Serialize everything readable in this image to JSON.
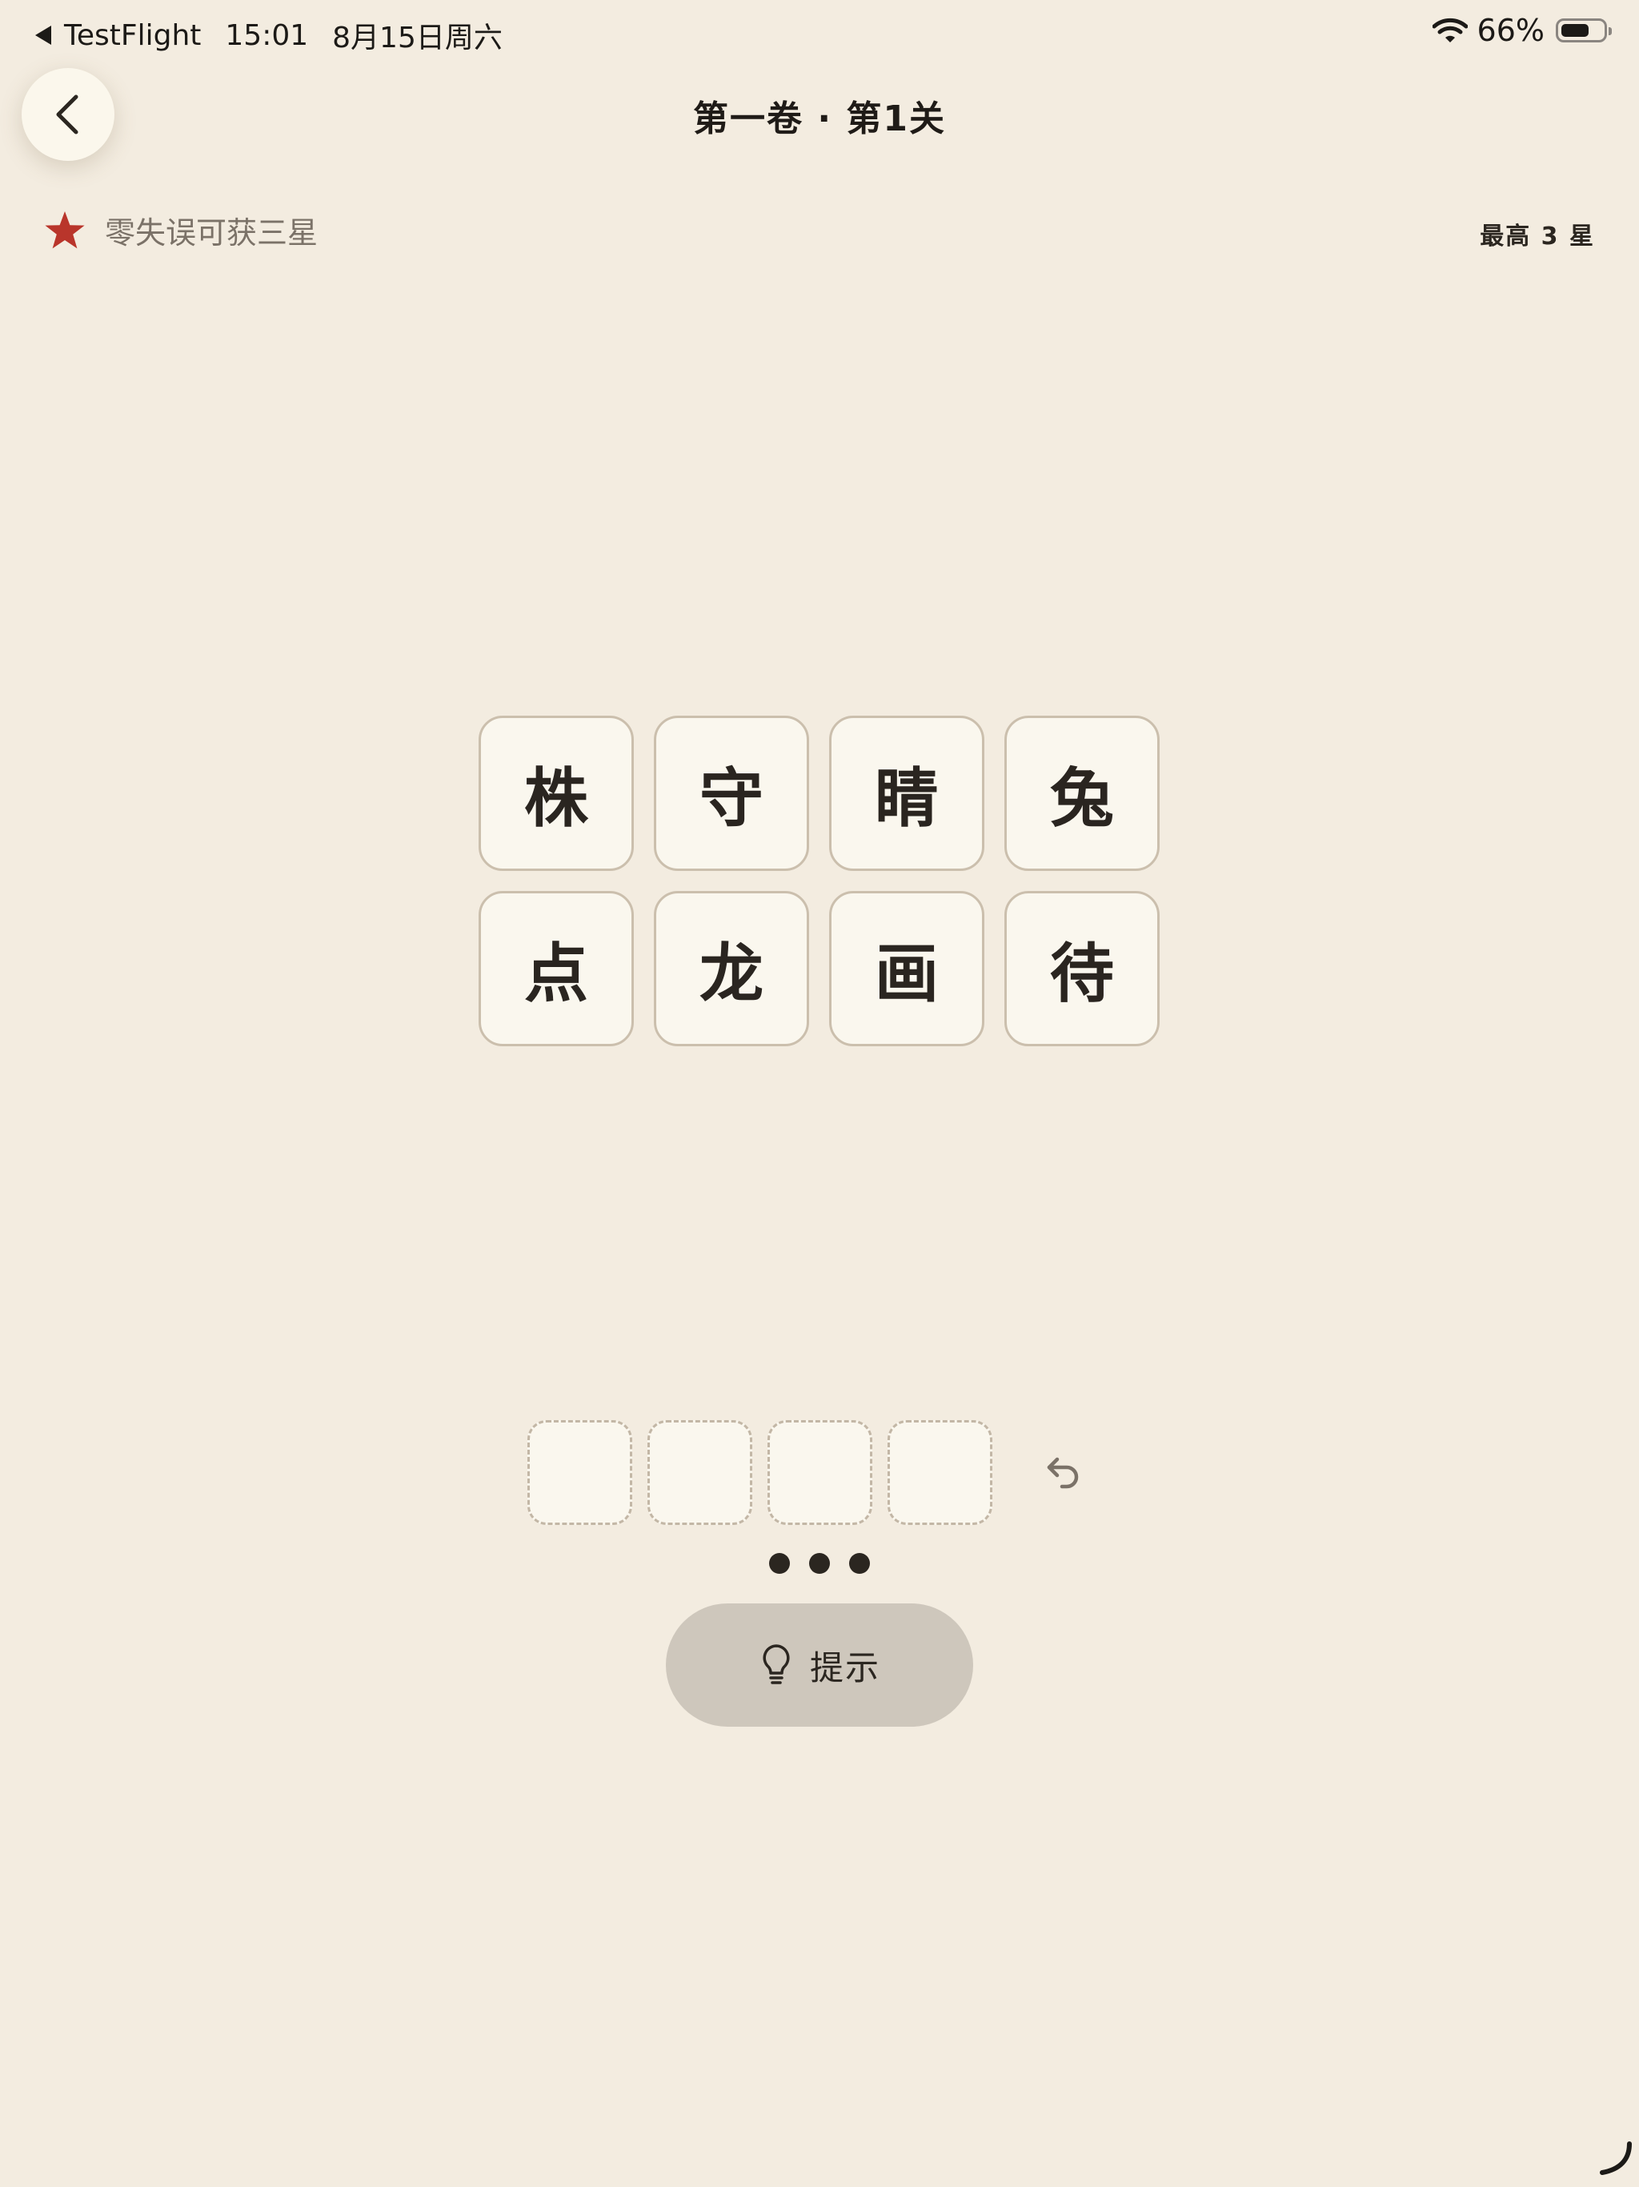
{
  "status_bar": {
    "back_app": "TestFlight",
    "time": "15:01",
    "date": "8月15日周六",
    "battery": "66%"
  },
  "header": {
    "title": "第一卷 · 第1关"
  },
  "goal": {
    "text": "零失误可获三星",
    "max_stars": "最高 3 星",
    "star_color": "#b9352b"
  },
  "tiles": [
    "株",
    "守",
    "睛",
    "兔",
    "点",
    "龙",
    "画",
    "待"
  ],
  "answer_slots": [
    "",
    "",
    "",
    ""
  ],
  "attempts_remaining": 3,
  "hint_button": {
    "label": "提示",
    "icon": "lightbulb-icon"
  },
  "colors": {
    "background": "#f3ece0",
    "tile_bg": "#faf7ee",
    "tile_border": "#cbbfad",
    "hint_bg": "#cec7bc"
  }
}
